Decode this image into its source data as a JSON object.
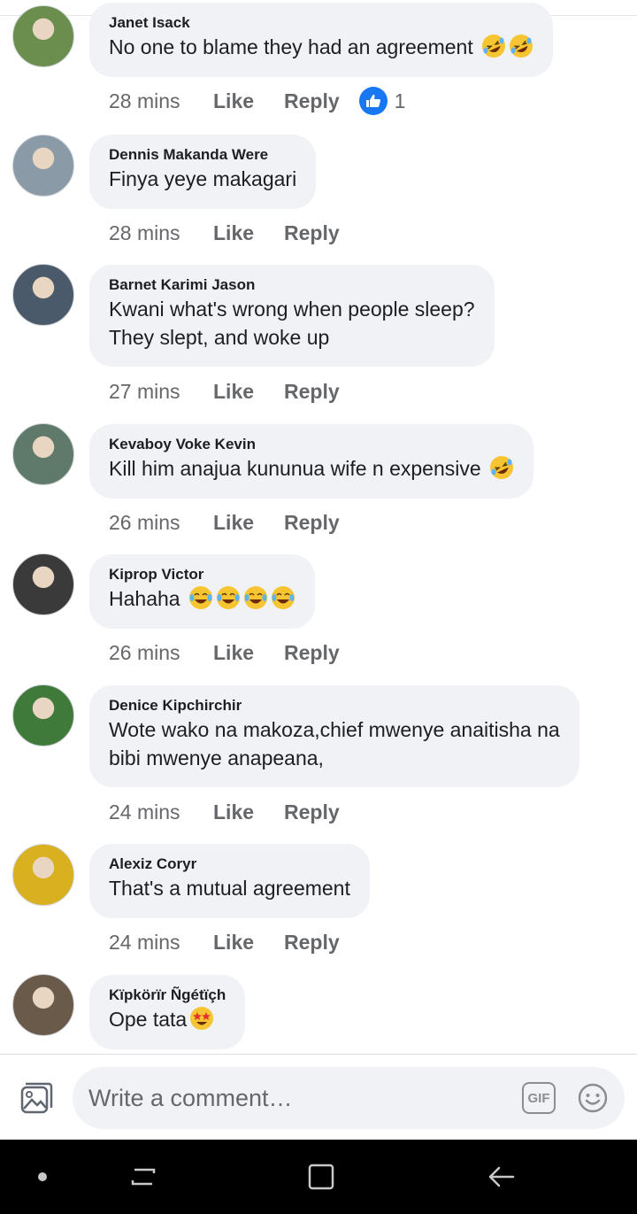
{
  "comments": [
    {
      "author": "Janet Isack",
      "lines": [
        "No one to blame they had an agreement"
      ],
      "emoji_count": 2,
      "emoji": "rofl",
      "time": "28 mins",
      "like": "Like",
      "reply": "Reply",
      "reaction_count": "1",
      "avatar_color": "#6b8e4e"
    },
    {
      "author": "Dennis Makanda Were",
      "lines": [
        "Finya yeye makagari"
      ],
      "emoji_count": 0,
      "time": "28 mins",
      "like": "Like",
      "reply": "Reply",
      "avatar_color": "#8a9aa6"
    },
    {
      "author": "Barnet Karimi Jason",
      "lines": [
        "Kwani what's wrong when people sleep?",
        "They slept, and woke up"
      ],
      "emoji_count": 0,
      "time": "27 mins",
      "like": "Like",
      "reply": "Reply",
      "avatar_color": "#4a5a6a"
    },
    {
      "author": "Kevaboy Voke Kevin",
      "lines": [
        "Kill him anajua kununua wife n expensive"
      ],
      "emoji_count": 1,
      "emoji": "rofl",
      "time": "26 mins",
      "like": "Like",
      "reply": "Reply",
      "avatar_color": "#5f7a6a"
    },
    {
      "author": "Kiprop Victor",
      "lines": [
        "Hahaha"
      ],
      "emoji_count": 4,
      "emoji": "joy",
      "time": "26 mins",
      "like": "Like",
      "reply": "Reply",
      "avatar_color": "#3a3a3a"
    },
    {
      "author": "Denice Kipchirchir",
      "lines": [
        "Wote wako na makoza,chief mwenye anaitisha na",
        "bibi mwenye anapeana,"
      ],
      "emoji_count": 0,
      "time": "24 mins",
      "like": "Like",
      "reply": "Reply",
      "avatar_color": "#3f7a3a"
    },
    {
      "author": "Alexiz Coryr",
      "lines": [
        "That's a mutual agreement"
      ],
      "emoji_count": 0,
      "time": "24 mins",
      "like": "Like",
      "reply": "Reply",
      "avatar_color": "#d8b020"
    },
    {
      "author": "Kïpkörïr Ñgétïçh",
      "lines": [
        "Ope tata"
      ],
      "emoji_count": 1,
      "emoji": "star-struck",
      "time": "",
      "like": "",
      "reply": "",
      "avatar_color": "#6a5a4a"
    }
  ],
  "composer": {
    "placeholder": "Write a comment…",
    "gif_label": "GIF",
    "photo_icon": "photo-icon",
    "emoji_icon": "smiley-icon"
  },
  "navbar": {
    "icons": [
      "dot-icon",
      "recent-apps-icon",
      "home-icon",
      "back-icon"
    ]
  },
  "colors": {
    "bubble": "#f0f2f5",
    "accent": "#1877f2",
    "meta": "#65676b"
  }
}
